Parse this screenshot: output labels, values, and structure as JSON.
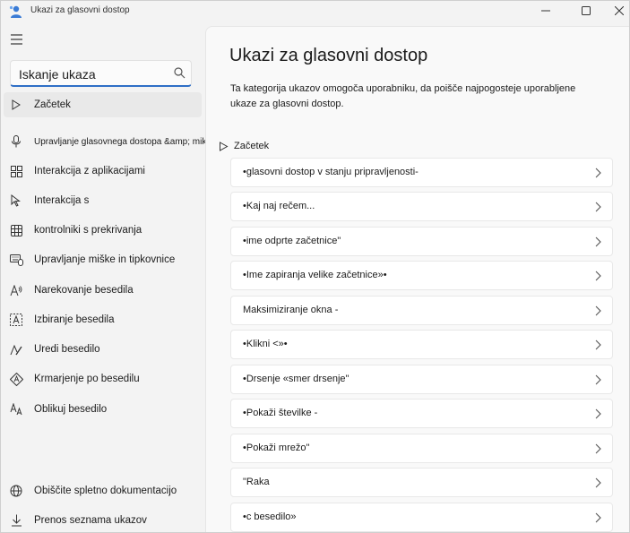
{
  "window": {
    "title": "Ukazi za glasovni dostop"
  },
  "sidebar": {
    "search": {
      "value": "Iskanje ukaza",
      "placeholder": "Iskanje ukaza"
    },
    "items": [
      {
        "label": "Začetek",
        "icon": "play-icon",
        "selected": true
      },
      {
        "label": "Upravljanje glasovnega dostopa &amp; mikrofona",
        "icon": "microphone-icon"
      },
      {
        "label": "Interakcija z aplikacijami",
        "icon": "apps-grid-icon"
      },
      {
        "label": "Interakcija s",
        "icon": "pointer-icon"
      },
      {
        "label": "kontrolniki s prekrivanja",
        "icon": "overlay-grid-icon"
      },
      {
        "label": "Upravljanje miške in tipkovnice",
        "icon": "keyboard-mouse-icon"
      },
      {
        "label": "Narekovanje besedila",
        "icon": "dictation-icon"
      },
      {
        "label": "Izbiranje besedila",
        "icon": "text-select-icon"
      },
      {
        "label": "Uredi besedilo",
        "icon": "edit-text-icon"
      },
      {
        "label": "Krmarjenje po besedilu",
        "icon": "navigate-text-icon"
      },
      {
        "label": "Oblikuj besedilo",
        "icon": "format-text-icon"
      }
    ],
    "footer_items": [
      {
        "label": "Obiščite spletno dokumentacijo",
        "icon": "globe-icon"
      },
      {
        "label": "Prenos seznama ukazov",
        "icon": "download-icon"
      }
    ]
  },
  "main": {
    "title": "Ukazi za glasovni dostop",
    "description": "Ta kategorija ukazov omogoča uporabniku, da poišče najpogosteje uporabljene ukaze za glasovni dostop.",
    "section_header": "Začetek",
    "commands": [
      "•glasovni dostop v stanju pripravljenosti-",
      "•Kaj naj rečem...",
      "•ime odprte začetnice\"",
      "•Ime zapiranja velike začetnice»•",
      "Maksimiziranje okna -",
      "•Klikni <»•",
      "•Drsenje «smer drsenje\"",
      "•Pokaži številke -",
      "•Pokaži mrežo\"",
      "\"Raka",
      "•c besedilo»"
    ]
  },
  "colors": {
    "accent": "#2f6fc6",
    "sidebar_bg": "#f3f3f3",
    "content_bg": "#f9f9f9",
    "card_bg": "#ffffff"
  }
}
